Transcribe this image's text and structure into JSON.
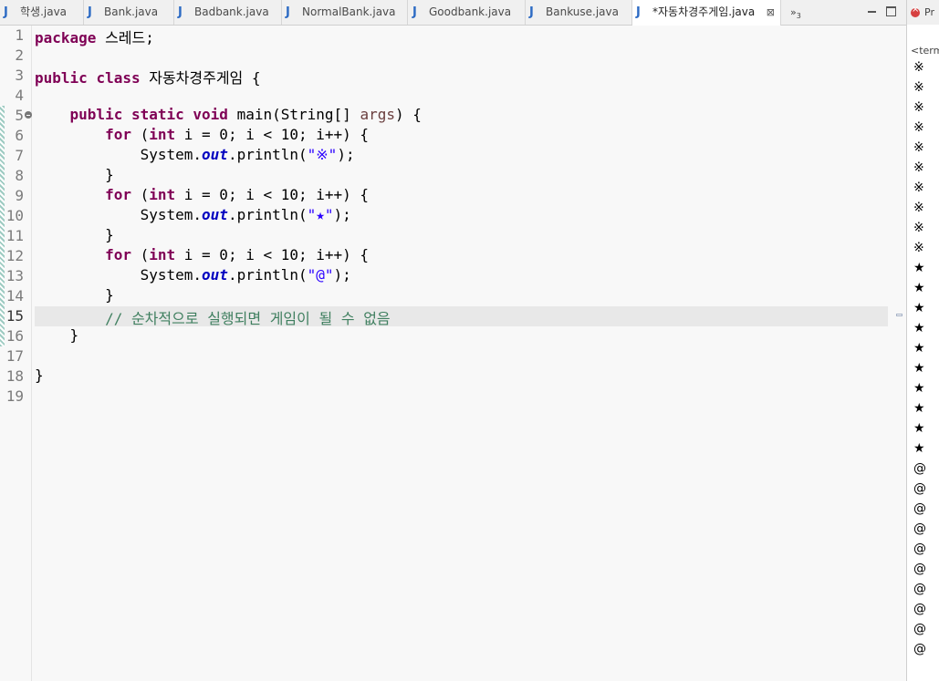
{
  "tabs": [
    {
      "label": "학생.java",
      "icon": "java-file-icon",
      "active": false
    },
    {
      "label": "Bank.java",
      "icon": "java-file-icon",
      "active": false
    },
    {
      "label": "Badbank.java",
      "icon": "java-file-icon",
      "active": false
    },
    {
      "label": "NormalBank.java",
      "icon": "java-file-icon",
      "active": false
    },
    {
      "label": "Goodbank.java",
      "icon": "java-file-icon",
      "active": false
    },
    {
      "label": "Bankuse.java",
      "icon": "java-file-icon",
      "active": false
    },
    {
      "label": "*자동차경주게임.java",
      "icon": "java-file-icon",
      "active": true
    }
  ],
  "tab_close_glyph": "⊠",
  "tab_overflow": {
    "chevron": "»",
    "count": "3"
  },
  "editor": {
    "current_line": 15,
    "lines": [
      {
        "n": "1",
        "code": [
          [
            "kw",
            "package"
          ],
          [
            "t",
            " 스레드;"
          ]
        ]
      },
      {
        "n": "2",
        "code": []
      },
      {
        "n": "3",
        "code": [
          [
            "kw",
            "public"
          ],
          [
            "t",
            " "
          ],
          [
            "kw",
            "class"
          ],
          [
            "t",
            " 자동차경주게임 {"
          ]
        ]
      },
      {
        "n": "4",
        "code": []
      },
      {
        "n": "5",
        "code": [
          [
            "t",
            "    "
          ],
          [
            "kw",
            "public"
          ],
          [
            "t",
            " "
          ],
          [
            "kw",
            "static"
          ],
          [
            "t",
            " "
          ],
          [
            "kw",
            "void"
          ],
          [
            "t",
            " main(String[] "
          ],
          [
            "param",
            "args"
          ],
          [
            "t",
            ") {"
          ]
        ]
      },
      {
        "n": "6",
        "code": [
          [
            "t",
            "        "
          ],
          [
            "kw",
            "for"
          ],
          [
            "t",
            " ("
          ],
          [
            "kw",
            "int"
          ],
          [
            "t",
            " i = 0; i < 10; i++) {"
          ]
        ]
      },
      {
        "n": "7",
        "code": [
          [
            "t",
            "            System."
          ],
          [
            "field",
            "out"
          ],
          [
            "t",
            ".println("
          ],
          [
            "str",
            "\"※\""
          ],
          [
            "t",
            ");"
          ]
        ]
      },
      {
        "n": "8",
        "code": [
          [
            "t",
            "        }"
          ]
        ]
      },
      {
        "n": "9",
        "code": [
          [
            "t",
            "        "
          ],
          [
            "kw",
            "for"
          ],
          [
            "t",
            " ("
          ],
          [
            "kw",
            "int"
          ],
          [
            "t",
            " i = 0; i < 10; i++) {"
          ]
        ]
      },
      {
        "n": "10",
        "code": [
          [
            "t",
            "            System."
          ],
          [
            "field",
            "out"
          ],
          [
            "t",
            ".println("
          ],
          [
            "str",
            "\"★\""
          ],
          [
            "t",
            ");"
          ]
        ]
      },
      {
        "n": "11",
        "code": [
          [
            "t",
            "        }"
          ]
        ]
      },
      {
        "n": "12",
        "code": [
          [
            "t",
            "        "
          ],
          [
            "kw",
            "for"
          ],
          [
            "t",
            " ("
          ],
          [
            "kw",
            "int"
          ],
          [
            "t",
            " i = 0; i < 10; i++) {"
          ]
        ]
      },
      {
        "n": "13",
        "code": [
          [
            "t",
            "            System."
          ],
          [
            "field",
            "out"
          ],
          [
            "t",
            ".println("
          ],
          [
            "str",
            "\"@\""
          ],
          [
            "t",
            ");"
          ]
        ]
      },
      {
        "n": "14",
        "code": [
          [
            "t",
            "        }"
          ]
        ]
      },
      {
        "n": "15",
        "code": [
          [
            "t",
            "        "
          ],
          [
            "cmt",
            "// 순차적으로 실행되면 게임이 될 수 없음"
          ]
        ]
      },
      {
        "n": "16",
        "code": [
          [
            "t",
            "    }"
          ]
        ]
      },
      {
        "n": "17",
        "code": []
      },
      {
        "n": "18",
        "code": [
          [
            "t",
            "}"
          ]
        ]
      },
      {
        "n": "19",
        "code": []
      }
    ]
  },
  "console": {
    "tab_label": "Pr",
    "header": "<term",
    "output": [
      "※",
      "※",
      "※",
      "※",
      "※",
      "※",
      "※",
      "※",
      "※",
      "※",
      "★",
      "★",
      "★",
      "★",
      "★",
      "★",
      "★",
      "★",
      "★",
      "★",
      "@",
      "@",
      "@",
      "@",
      "@",
      "@",
      "@",
      "@",
      "@",
      "@"
    ]
  }
}
